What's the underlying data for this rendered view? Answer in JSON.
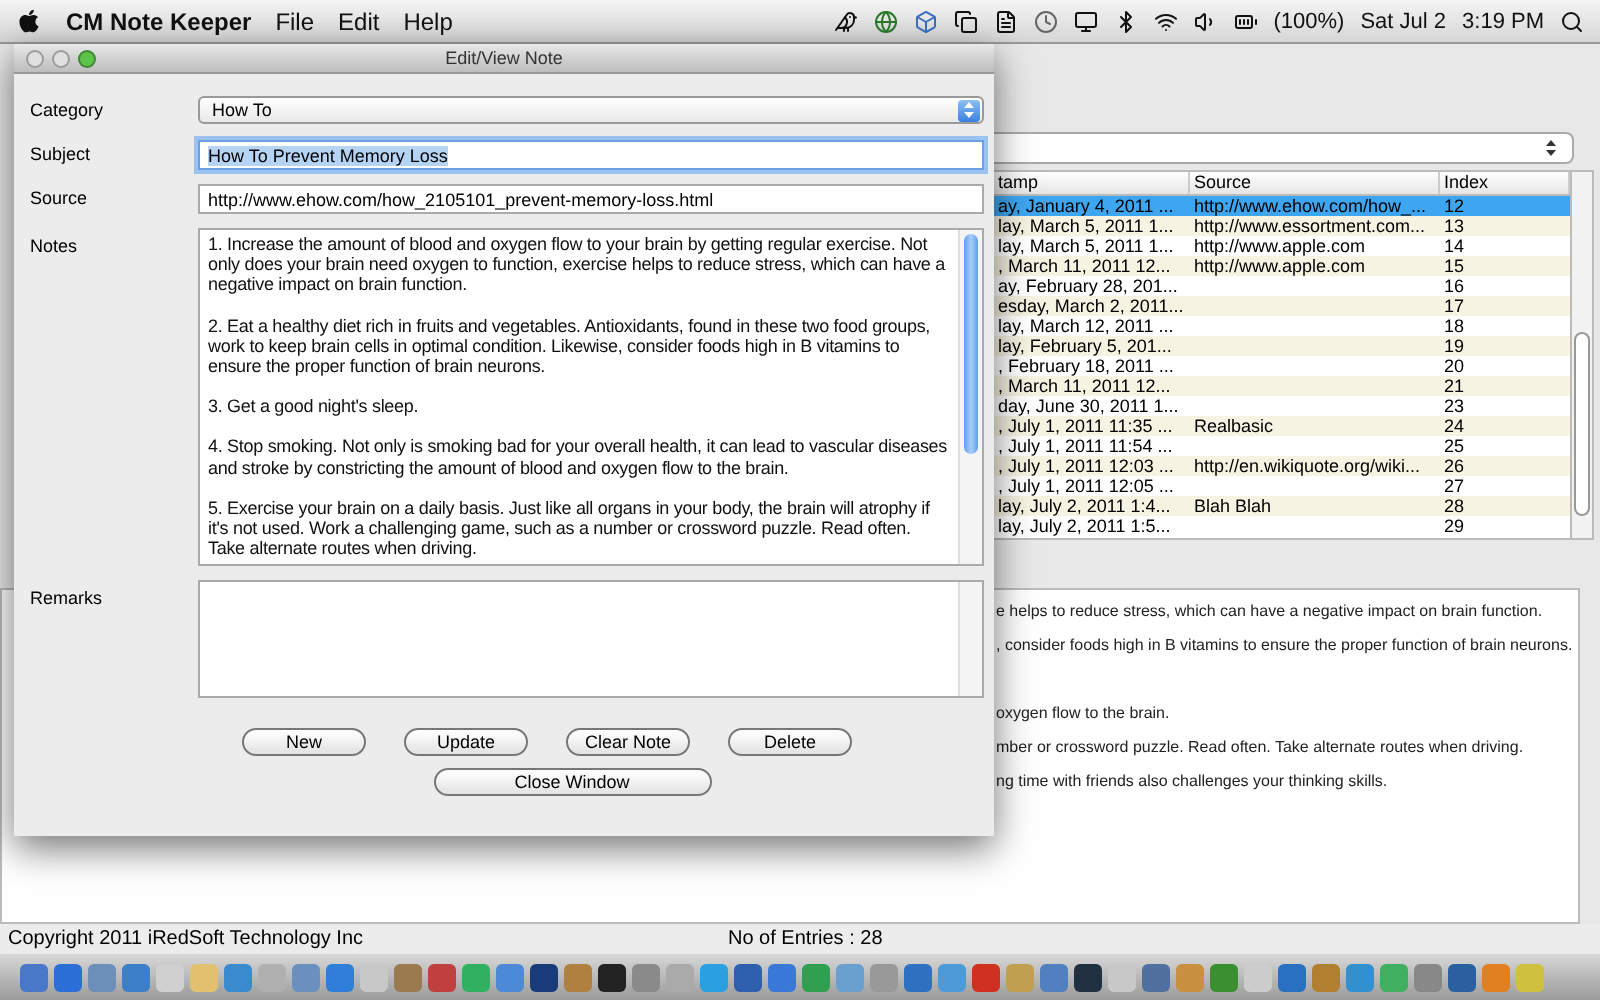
{
  "menubar": {
    "app_name": "CM Note Keeper",
    "menus": [
      "File",
      "Edit",
      "Help"
    ],
    "battery": "(100%)",
    "date": "Sat Jul 2",
    "time": "3:19 PM"
  },
  "main_window": {
    "table": {
      "columns": [
        "tamp",
        "Source",
        "Index"
      ],
      "rows": [
        {
          "stamp": "ay, January 4, 2011 ...",
          "source": "http://www.ehow.com/how_...",
          "index": "12",
          "selected": true
        },
        {
          "stamp": "lay, March 5, 2011 1...",
          "source": "http://www.essortment.com...",
          "index": "13",
          "selected": false
        },
        {
          "stamp": "lay, March 5, 2011 1...",
          "source": "http://www.apple.com",
          "index": "14",
          "selected": false
        },
        {
          "stamp": ", March 11, 2011 12...",
          "source": "http://www.apple.com",
          "index": "15",
          "selected": false
        },
        {
          "stamp": "ay, February 28, 201...",
          "index": "16",
          "selected": false
        },
        {
          "stamp": "esday, March 2, 2011...",
          "index": "17",
          "selected": false
        },
        {
          "stamp": "lay, March 12, 2011 ...",
          "index": "18",
          "selected": false
        },
        {
          "stamp": "lay, February 5, 201...",
          "index": "19",
          "selected": false
        },
        {
          "stamp": ", February 18, 2011 ...",
          "index": "20",
          "selected": false
        },
        {
          "stamp": ", March 11, 2011 12...",
          "index": "21",
          "selected": false
        },
        {
          "stamp": "day, June 30, 2011 1...",
          "index": "23",
          "selected": false
        },
        {
          "stamp": ", July 1, 2011 11:35 ...",
          "source": "Realbasic",
          "index": "24",
          "selected": false
        },
        {
          "stamp": ", July 1, 2011 11:54 ...",
          "index": "25",
          "selected": false
        },
        {
          "stamp": ", July 1, 2011 12:03 ...",
          "source": "http://en.wikiquote.org/wiki...",
          "index": "26",
          "selected": false
        },
        {
          "stamp": ", July 1, 2011 12:05 ...",
          "index": "27",
          "selected": false
        },
        {
          "stamp": "lay, July 2, 2011 1:4...",
          "source": "Blah Blah",
          "index": "28",
          "selected": false
        },
        {
          "stamp": "lay, July 2, 2011 1:5...",
          "index": "29",
          "selected": false
        }
      ]
    },
    "note_blocks": [
      [
        "e helps to reduce stress, which can have a negative impact on brain function.",
        ", consider foods high in B vitamins to ensure the proper function of brain neurons."
      ],
      [
        "oxygen flow to the brain.",
        "mber or crossword puzzle. Read often. Take alternate routes when driving.",
        "ng time with friends also challenges your thinking skills."
      ]
    ],
    "status_bar": {
      "copyright": "Copyright 2011 iRedSoft Technology Inc",
      "entries": "No of Entries : 28"
    }
  },
  "dialog": {
    "title": "Edit/View Note",
    "fields": [
      {
        "kind": "popup",
        "label": "Category",
        "value": "How To"
      },
      {
        "kind": "text",
        "label": "Subject",
        "value": "How To Prevent Memory Loss",
        "focused": true
      },
      {
        "kind": "text",
        "label": "Source",
        "value": "http://www.ehow.com/how_2105101_prevent-memory-loss.html",
        "focused": false
      },
      {
        "kind": "notes",
        "label": "Notes",
        "paragraphs": [
          "1. Increase the amount of blood and oxygen flow to your brain by getting regular exercise. Not only does your brain need oxygen to function, exercise helps to reduce stress, which can have a negative impact on brain function.",
          "2. Eat a healthy diet rich in fruits and vegetables. Antioxidants, found in these two food groups, work to keep brain cells in optimal condition. Likewise, consider foods high in B vitamins to ensure the proper function of brain neurons.",
          "3. Get a good night's sleep.",
          "4. Stop smoking. Not only is smoking bad for your overall health, it can lead to vascular diseases and stroke by constricting the amount of blood and oxygen flow to the brain.",
          "5. Exercise your brain on a daily basis. Just like all organs in your body, the brain will atrophy if it's not used. Work a challenging game, such as a number or crossword puzzle. Read often. Take alternate routes when driving."
        ]
      },
      {
        "kind": "remarks",
        "label": "Remarks"
      }
    ],
    "buttons": [
      "New",
      "Update",
      "Clear Note",
      "Delete"
    ],
    "close_button": "Close Window"
  }
}
